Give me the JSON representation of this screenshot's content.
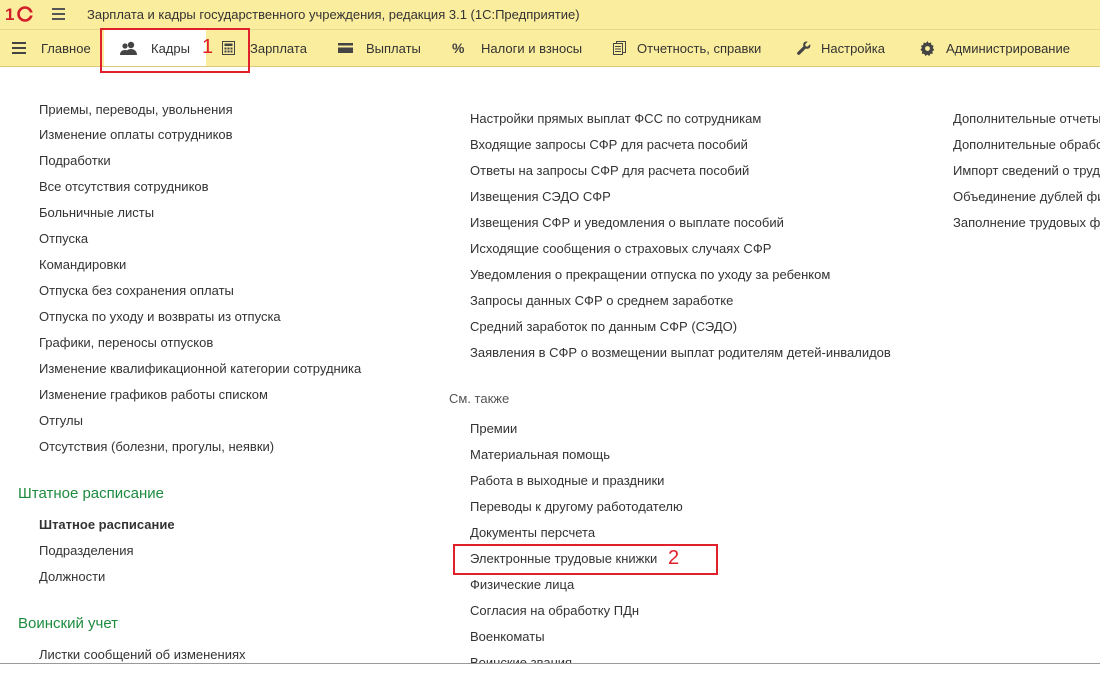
{
  "window": {
    "title": "Зарплата и кадры государственного учреждения, редакция 3.1  (1С:Предприятие)",
    "logo_text": "1С"
  },
  "menu": [
    {
      "label": "Главное",
      "icon": "hamburger-icon"
    },
    {
      "label": "Кадры",
      "icon": "people-icon",
      "active": true
    },
    {
      "label": "Зарплата",
      "icon": "calculator-icon"
    },
    {
      "label": "Выплаты",
      "icon": "wallet-icon"
    },
    {
      "label": "Налоги и взносы",
      "icon": "percent-icon"
    },
    {
      "label": "Отчетность, справки",
      "icon": "documents-icon"
    },
    {
      "label": "Настройка",
      "icon": "wrench-icon"
    },
    {
      "label": "Администрирование",
      "icon": "gear-icon"
    }
  ],
  "col1": {
    "items": [
      "Приемы, переводы, увольнения",
      "Изменение оплаты сотрудников",
      "Подработки",
      "Все отсутствия сотрудников",
      "Больничные листы",
      "Отпуска",
      "Командировки",
      "Отпуска без сохранения оплаты",
      "Отпуска по уходу и возвраты из отпуска",
      "Графики, переносы отпусков",
      "Изменение квалификационной категории сотрудника",
      "Изменение графиков работы списком",
      "Отгулы",
      "Отсутствия (болезни, прогулы, неявки)"
    ],
    "staff_group": "Штатное расписание",
    "staff_items": [
      "Штатное расписание",
      "Подразделения",
      "Должности"
    ],
    "military_group": "Воинский учет",
    "military_items": [
      "Листки сообщений об изменениях"
    ]
  },
  "col2": {
    "items": [
      "Настройки прямых выплат ФСС по сотрудникам",
      "Входящие запросы СФР для расчета пособий",
      "Ответы на запросы СФР для расчета пособий",
      "Извещения СЭДО СФР",
      "Извещения СФР и уведомления о выплате пособий",
      "Исходящие сообщения о страховых случаях СФР",
      "Уведомления о прекращении отпуска по уходу за ребенком",
      "Запросы данных СФР о среднем заработке",
      "Средний заработок по данным СФР (СЭДО)",
      "Заявления в СФР о возмещении выплат родителям детей-инвалидов"
    ],
    "see_also_label": "См. также",
    "see_also": [
      "Премии",
      "Материальная помощь",
      "Работа в выходные и праздники",
      "Переводы к другому работодателю",
      "Документы персчета",
      "Электронные трудовые книжки",
      "Физические лица",
      "Согласия на обработку ПДн",
      "Военкоматы",
      "Воинские звания"
    ]
  },
  "col3": {
    "items": [
      "Дополнительные отчеты",
      "Дополнительные обработ",
      "Импорт сведений о труд",
      "Объединение дублей фи",
      "Заполнение трудовых фу"
    ]
  },
  "annotations": {
    "n1": "1",
    "n2": "2"
  },
  "colors": {
    "toolbar": "#fbed9e",
    "group_heading": "#1d8b3e",
    "highlight": "#e0202a"
  }
}
